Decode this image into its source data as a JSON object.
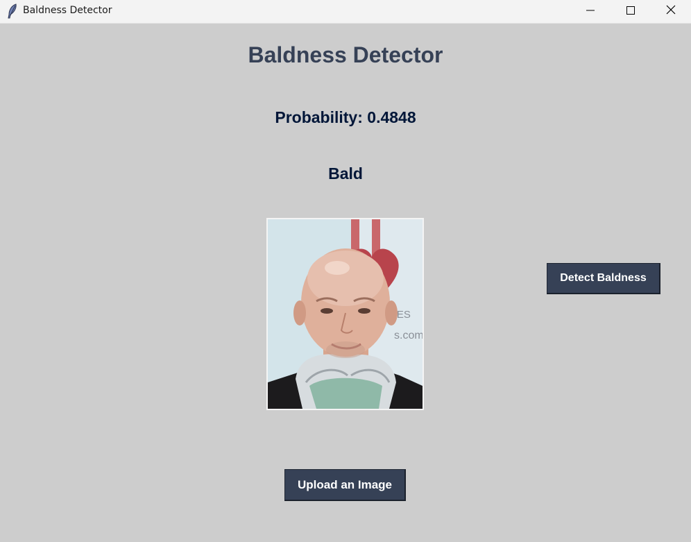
{
  "window": {
    "title": "Baldness Detector",
    "icon": "feather-icon"
  },
  "titlebar_controls": [
    "minimize-icon",
    "maximize-icon",
    "close-icon"
  ],
  "main": {
    "heading": "Baldness Detector",
    "probability_text": "Probability: 0.4848",
    "result_text": "Bald"
  },
  "image_panel": {
    "watermark_partial_1": "RES",
    "watermark_partial_2": "s.com"
  },
  "buttons": {
    "detect_label": "Detect Baldness",
    "upload_label": "Upload an Image"
  },
  "colors": {
    "background": "#cdcdcd",
    "heading": "#364156",
    "result_text": "#011638",
    "button_bg": "#364156",
    "button_text": "#ffffff"
  }
}
